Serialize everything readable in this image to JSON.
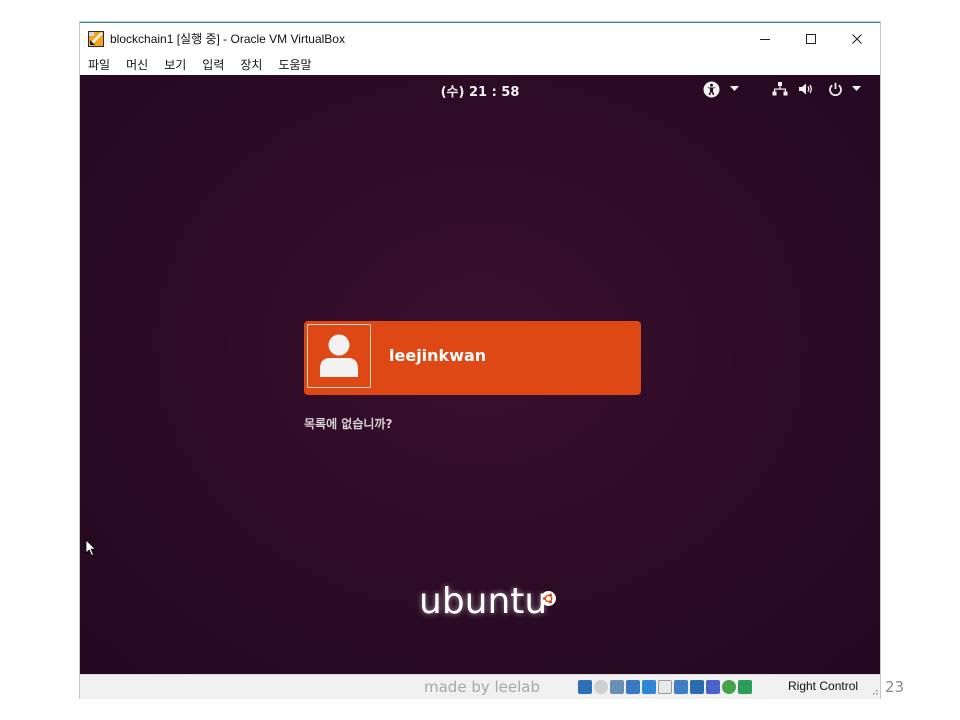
{
  "window": {
    "title": "blockchain1 [실행 중] - Oracle VM VirtualBox",
    "minimize_glyph": "—",
    "maximize_glyph": "☐",
    "close_glyph": "✕"
  },
  "menubar": {
    "items": [
      {
        "label": "파일"
      },
      {
        "label": "머신"
      },
      {
        "label": "보기"
      },
      {
        "label": "입력"
      },
      {
        "label": "장치"
      },
      {
        "label": "도움말"
      }
    ]
  },
  "vm": {
    "clock": "(수) 21 : 58",
    "panel_icons": [
      "accessibility-icon",
      "chevron-down-icon",
      "network-icon",
      "volume-icon",
      "power-icon",
      "chevron-down-icon"
    ],
    "user": {
      "name": "leejinkwan"
    },
    "not_listed_text": "목록에 없습니까?",
    "logo_text": "ubuntu"
  },
  "statusbar": {
    "icons": [
      "hard-disk-icon",
      "optical-drive-icon",
      "audio-icon",
      "network-adapter-icon",
      "usb-icon",
      "shared-folder-icon",
      "display-icon",
      "recording-icon",
      "virtualization-icon",
      "mouse-integration-icon",
      "host-key-icon"
    ],
    "host_key_label": "Right Control"
  },
  "slide": {
    "watermark": "made by leelab",
    "page_number": "23"
  },
  "colors": {
    "card": "#dd4814",
    "background": "#2c0b25",
    "statusbar": "#f0f0f0"
  }
}
